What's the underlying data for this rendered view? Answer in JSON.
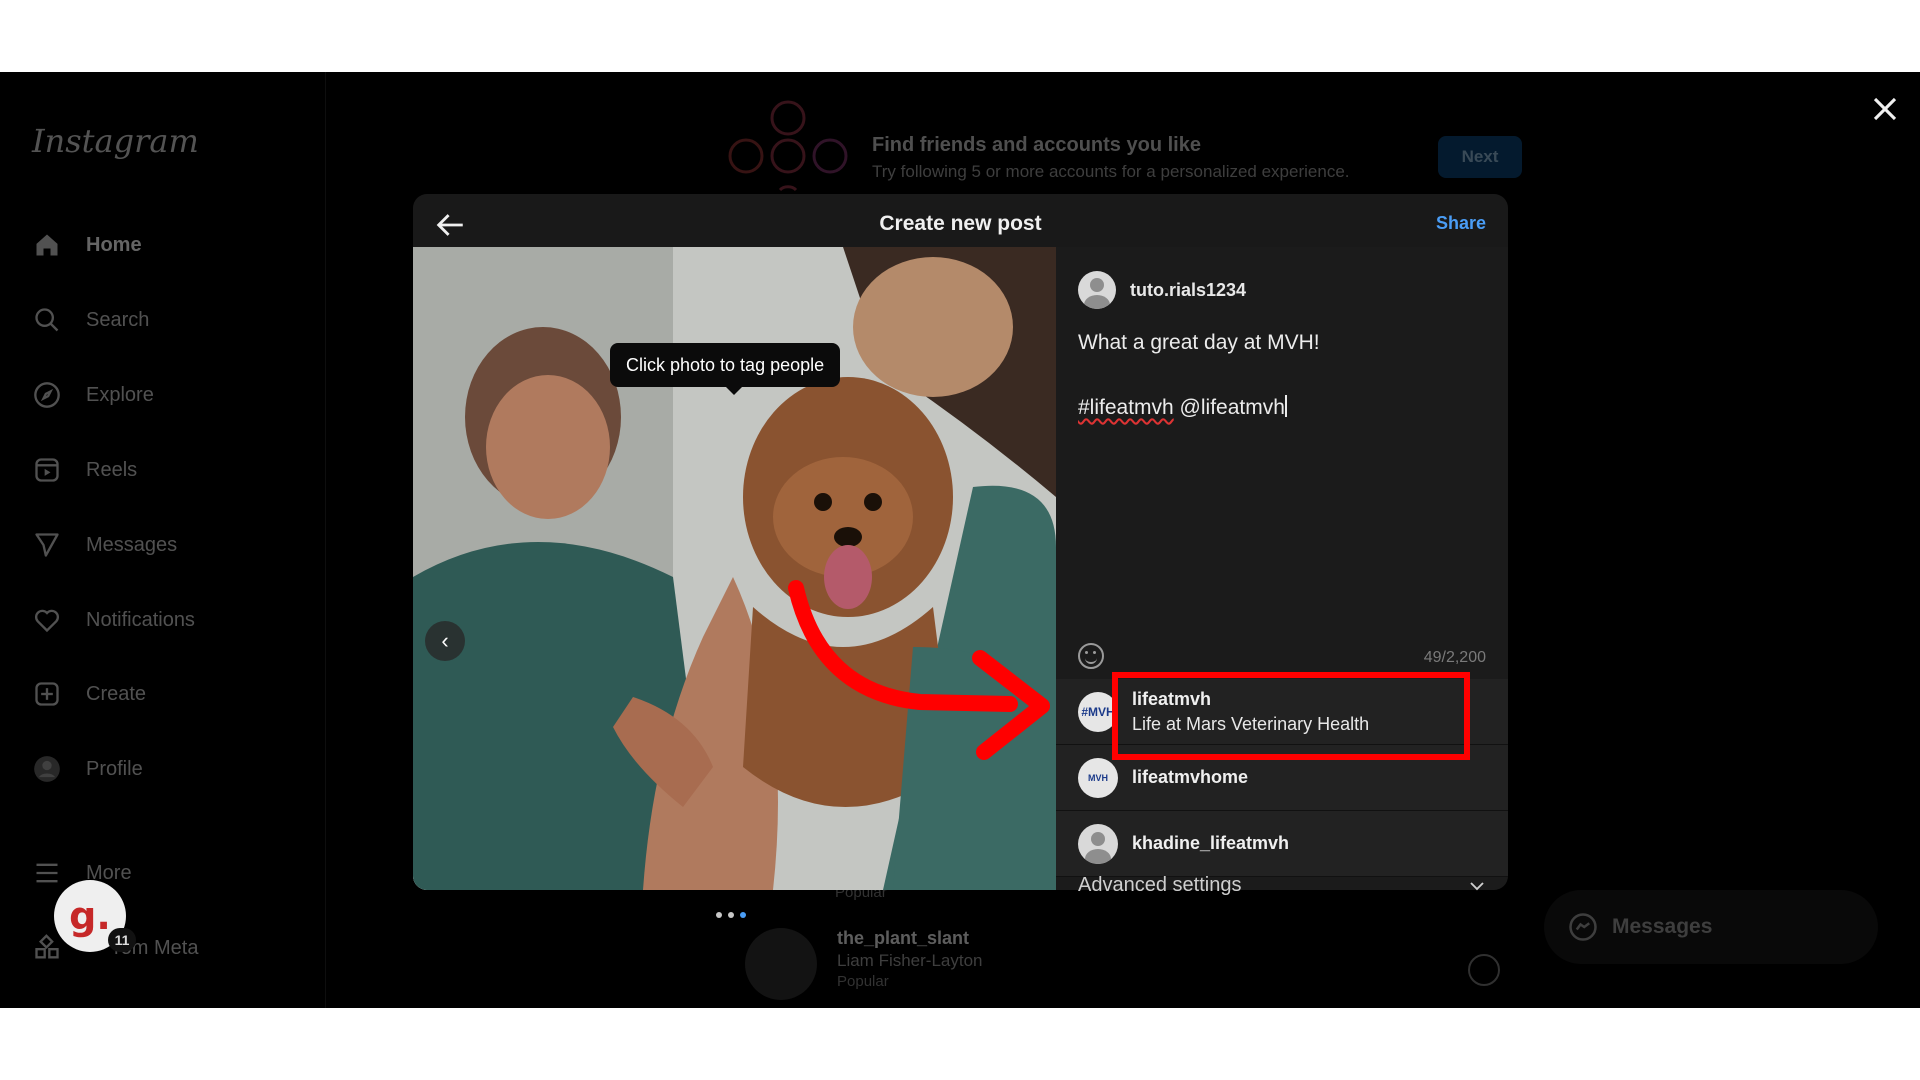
{
  "sidebar": {
    "logo": "Instagram",
    "items": [
      {
        "label": "Home",
        "icon": "home-icon"
      },
      {
        "label": "Search",
        "icon": "search-icon"
      },
      {
        "label": "Explore",
        "icon": "compass-icon"
      },
      {
        "label": "Reels",
        "icon": "reels-icon"
      },
      {
        "label": "Messages",
        "icon": "send-icon"
      },
      {
        "label": "Notifications",
        "icon": "heart-icon"
      },
      {
        "label": "Create",
        "icon": "plus-square-icon"
      },
      {
        "label": "Profile",
        "icon": "profile-avatar"
      },
      {
        "label": "More",
        "icon": "menu-icon"
      },
      {
        "label": "rom Meta",
        "icon": "grid-icon"
      }
    ]
  },
  "suggest": {
    "title": "Find friends and accounts you like",
    "subtitle": "Try following 5 or more accounts for a personalized experience.",
    "next_label": "Next"
  },
  "feed": {
    "row1_popular": "Popular",
    "row2": {
      "name": "the_plant_slant",
      "sub": "Liam Fisher-Layton",
      "popular": "Popular"
    }
  },
  "modal": {
    "title": "Create new post",
    "share_label": "Share",
    "tag_tooltip": "Click photo to tag people",
    "username": "tuto.rials1234",
    "caption_line1": "What a great day at MVH!",
    "caption_hashtag": "#lifeatmvh",
    "caption_mention": " @lifeatmvh",
    "char_count": "49/2,200",
    "advanced_label": "Advanced settings"
  },
  "mentions": [
    {
      "username": "lifeatmvh",
      "full_name": "Life at Mars Veterinary Health",
      "avatar_text": "#MVH"
    },
    {
      "username": "lifeatmvhome",
      "full_name": "",
      "avatar_text": "MVH"
    },
    {
      "username": "khadine_lifeatmvh",
      "full_name": "",
      "avatar_text": ""
    }
  ],
  "badge": {
    "letter": "g.",
    "count": "11"
  },
  "messages_pill": {
    "label": "Messages"
  },
  "colors": {
    "accent": "#4a9df5",
    "annotation": "#ff0000",
    "badge_letter": "#c62828"
  }
}
